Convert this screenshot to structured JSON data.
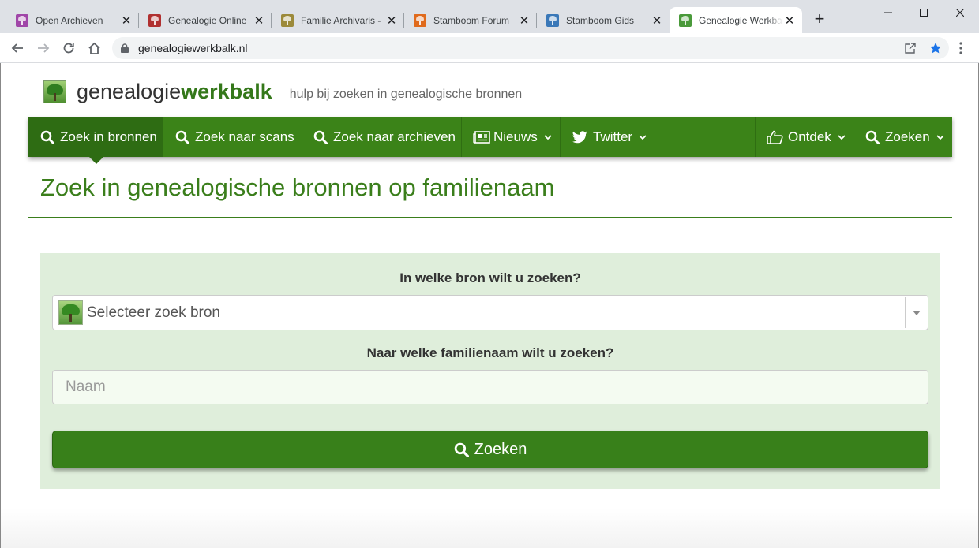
{
  "browser": {
    "tabs": [
      {
        "title": "Open Archieven",
        "color": "#a046a8",
        "active": false
      },
      {
        "title": "Genealogie Online",
        "color": "#b03030",
        "active": false
      },
      {
        "title": "Familie Archivaris - ",
        "color": "#9c8a3a",
        "active": false
      },
      {
        "title": "Stamboom Forum",
        "color": "#e06a1c",
        "active": false
      },
      {
        "title": "Stamboom Gids",
        "color": "#3a78b8",
        "active": false
      },
      {
        "title": "Genealogie Werkbalk",
        "color": "#4a9a3a",
        "active": true
      }
    ],
    "new_tab": "+",
    "url": "genealogiewerkbalk.nl"
  },
  "site": {
    "brand_light": "genealogie",
    "brand_bold": "werkbalk",
    "tagline": "hulp bij zoeken in genealogische bronnen"
  },
  "nav": {
    "items": [
      {
        "label": "Zoek in bronnen",
        "icon": "search-icon"
      },
      {
        "label": "Zoek naar scans",
        "icon": "search-icon"
      },
      {
        "label": "Zoek naar archieven",
        "icon": "search-icon"
      },
      {
        "label": "Nieuws",
        "icon": "newspaper-icon"
      },
      {
        "label": "Twitter",
        "icon": "twitter-icon"
      },
      {
        "label": "Ontdek",
        "icon": "thumbs-up-icon"
      },
      {
        "label": "Zoeken",
        "icon": "search-icon"
      }
    ]
  },
  "main": {
    "heading": "Zoek in genealogische bronnen op familienaam",
    "source_label": "In welke bron wilt u zoeken?",
    "source_select": "Selecteer zoek bron",
    "name_label": "Naar welke familienaam wilt u zoeken?",
    "name_placeholder": "Naam",
    "search_button": "Zoeken"
  },
  "colors": {
    "accent": "#3b8318",
    "accent_dark": "#2e6c13",
    "panel": "#dfeedb"
  }
}
